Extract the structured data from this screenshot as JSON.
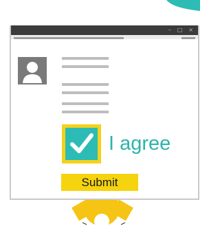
{
  "window": {
    "controls": {
      "minimize": "–",
      "maximize": "□",
      "close": "×"
    }
  },
  "consent": {
    "checked": true,
    "label": "I agree"
  },
  "form": {
    "submit_label": "Submit"
  },
  "colors": {
    "accent_teal": "#2cbcb5",
    "accent_yellow": "#f5d30f",
    "titlebar": "#3b3b3b",
    "placeholder_line": "#bdbdbd"
  },
  "icons": [
    "avatar-icon",
    "checkmark-icon",
    "gear-icon",
    "window-minimize-icon",
    "window-maximize-icon",
    "window-close-icon"
  ]
}
